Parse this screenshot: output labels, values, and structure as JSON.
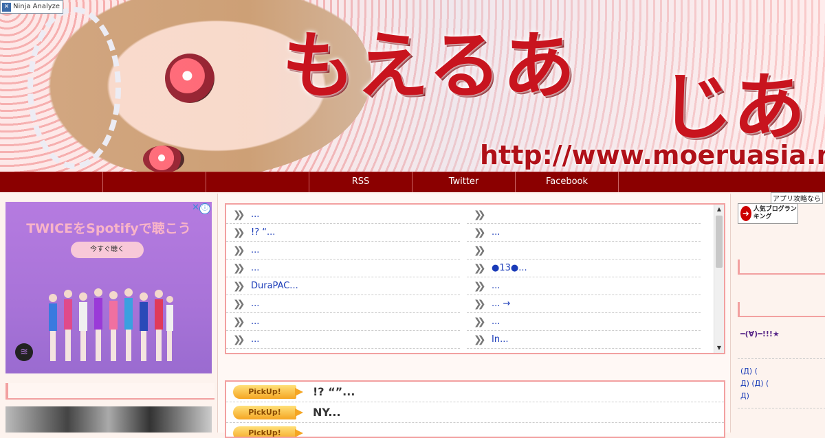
{
  "header": {
    "ninja_label": "Ninja Analyze",
    "site_title": "もえるあ",
    "site_title_2": "じあ",
    "url_text": "http://www.moeruasia.net"
  },
  "nav": {
    "tabs": [
      {
        "label": ""
      },
      {
        "label": ""
      },
      {
        "label": ""
      },
      {
        "label": "RSS"
      },
      {
        "label": "Twitter"
      },
      {
        "label": "Facebook"
      }
    ]
  },
  "left": {
    "ad": {
      "title": "TWICEをSpotifyで聴こう",
      "button": "今すぐ聴く",
      "info": "ⓘ",
      "close": "✕"
    }
  },
  "main": {
    "list_left": [
      "...",
      "!? “...",
      "...",
      "...",
      "DuraPAC...",
      "...",
      "...",
      "..."
    ],
    "list_right": [
      "",
      "...",
      "",
      "●13●...",
      "...",
      "... →",
      "...",
      "In..."
    ],
    "pickups": [
      {
        "badge": "PickUp!",
        "text": "!? “”..."
      },
      {
        "badge": "PickUp!",
        "text": "NY..."
      },
      {
        "badge": "PickUp!",
        "text": ""
      }
    ]
  },
  "right": {
    "app_tag": "アプリ攻略なら",
    "ranking_label": "人気ブログランキング",
    "text1": "━(∀)━!!!★",
    "text2_lines": [
      "(Д) (",
      "Д) (Д) (",
      "Д)"
    ]
  },
  "colors": {
    "nav_bg": "#8b0000",
    "accent_pink": "#f2a0a0",
    "link_blue": "#1a3bb8",
    "title_red": "#c8141e"
  }
}
